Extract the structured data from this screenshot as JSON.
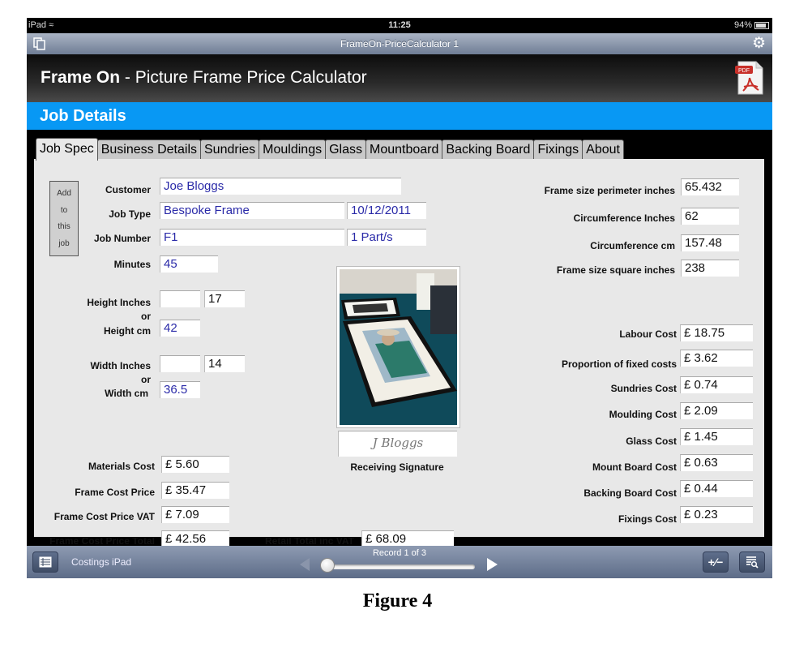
{
  "status_bar": {
    "device": "iPad",
    "time": "11:25",
    "battery": "94%"
  },
  "navbar": {
    "title": "FrameOn-PriceCalculator 1",
    "left_icon": "duplicate-icon",
    "right_icon": "gear-icon"
  },
  "header": {
    "brand": "Frame On",
    "subtitle": " - Picture Frame Price Calculator",
    "pdf_badge": "PDF"
  },
  "section": {
    "title": "Job Details"
  },
  "tabs": [
    {
      "label": "Job Spec",
      "active": true
    },
    {
      "label": "Business Details"
    },
    {
      "label": "Sundries"
    },
    {
      "label": "Mouldings"
    },
    {
      "label": "Glass"
    },
    {
      "label": "Mountboard"
    },
    {
      "label": "Backing Board"
    },
    {
      "label": "Fixings"
    },
    {
      "label": "About"
    }
  ],
  "job": {
    "add_button": [
      "Add",
      "to",
      "this",
      "job"
    ],
    "customer_label": "Customer",
    "customer": "Joe Bloggs",
    "job_type_label": "Job Type",
    "job_type": "Bespoke Frame",
    "date": "10/12/2011",
    "job_number_label": "Job Number",
    "job_number": "F1",
    "parts": "1 Part/s",
    "minutes_label": "Minutes",
    "minutes": "45",
    "height_inches_label": "Height Inches",
    "height_inches_input": "",
    "height_inches": "17",
    "or": "or",
    "height_cm_label": "Height cm",
    "height_cm": "42",
    "width_inches_label": "Width Inches",
    "width_inches_input": "",
    "width_inches": "14",
    "width_cm_label": "Width cm",
    "width_cm": "36.5",
    "materials_cost_label": "Materials Cost",
    "materials_cost": "£  5.60",
    "frame_cost_price_label": "Frame Cost Price",
    "frame_cost_price": "£  35.47",
    "frame_cost_vat_label": "Frame Cost Price VAT",
    "frame_cost_vat": "£  7.09",
    "frame_cost_total_label": "Frame Cost Price Total",
    "frame_cost_total": "£  42.56",
    "retail_total_label": "Retail Total inc VAT",
    "retail_total": "£  68.09",
    "signature": "J Bloggs",
    "signature_label": "Receiving Signature"
  },
  "measurements": [
    {
      "label": "Frame size perimeter inches",
      "value": "65.432"
    },
    {
      "label": "Circumference Inches",
      "value": "62"
    },
    {
      "label": "Circumference cm",
      "value": "157.48"
    },
    {
      "label": "Frame size square inches",
      "value": "238"
    }
  ],
  "costs": [
    {
      "label": "Labour Cost",
      "value": "£  18.75"
    },
    {
      "label": "Proportion of fixed costs",
      "value": "£  3.62"
    },
    {
      "label": "Sundries Cost",
      "value": "£  0.74"
    },
    {
      "label": "Moulding Cost",
      "value": "£  2.09"
    },
    {
      "label": "Glass Cost",
      "value": "£  1.45"
    },
    {
      "label": "Mount Board Cost",
      "value": "£  0.63"
    },
    {
      "label": "Backing Board Cost",
      "value": "£  0.44"
    },
    {
      "label": "Fixings Cost",
      "value": "£  0.23"
    }
  ],
  "bottom_bar": {
    "layout_name": "Costings iPad",
    "record": "Record 1 of 3",
    "record_position": 1,
    "record_total": 3
  },
  "caption": "Figure 4",
  "colors": {
    "section_blue": "#0898f4",
    "value_blue": "#2a2aa8"
  }
}
